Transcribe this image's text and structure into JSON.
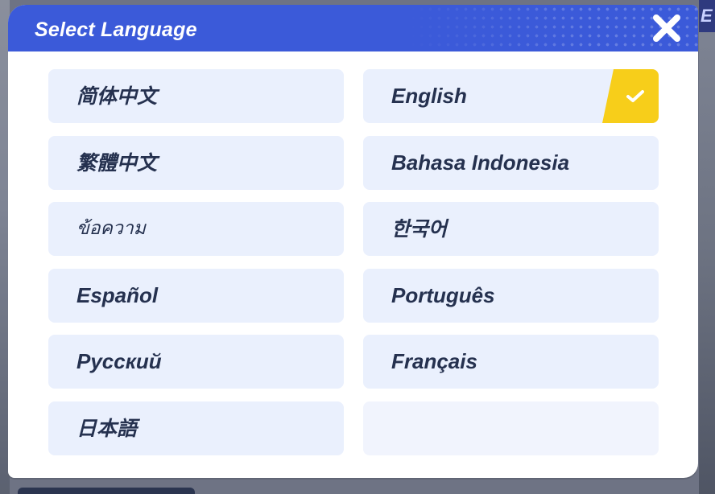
{
  "background": {
    "right_chip_text": "E"
  },
  "dialog": {
    "title": "Select Language",
    "close_icon": "close-icon",
    "selected_language": "English",
    "languages": [
      {
        "label": "简体中文"
      },
      {
        "label": "English",
        "selected": true
      },
      {
        "label": "繁體中文"
      },
      {
        "label": "Bahasa Indonesia"
      },
      {
        "label": "ข้อความ"
      },
      {
        "label": "한국어"
      },
      {
        "label": "Español"
      },
      {
        "label": "Português"
      },
      {
        "label": "Русский"
      },
      {
        "label": "Français"
      },
      {
        "label": "日本語"
      },
      {
        "label": ""
      }
    ]
  },
  "colors": {
    "header": "#3b5ad9",
    "option_bg": "#eaf0fd",
    "option_text": "#25314f",
    "selected_accent": "#f7ce1a"
  }
}
